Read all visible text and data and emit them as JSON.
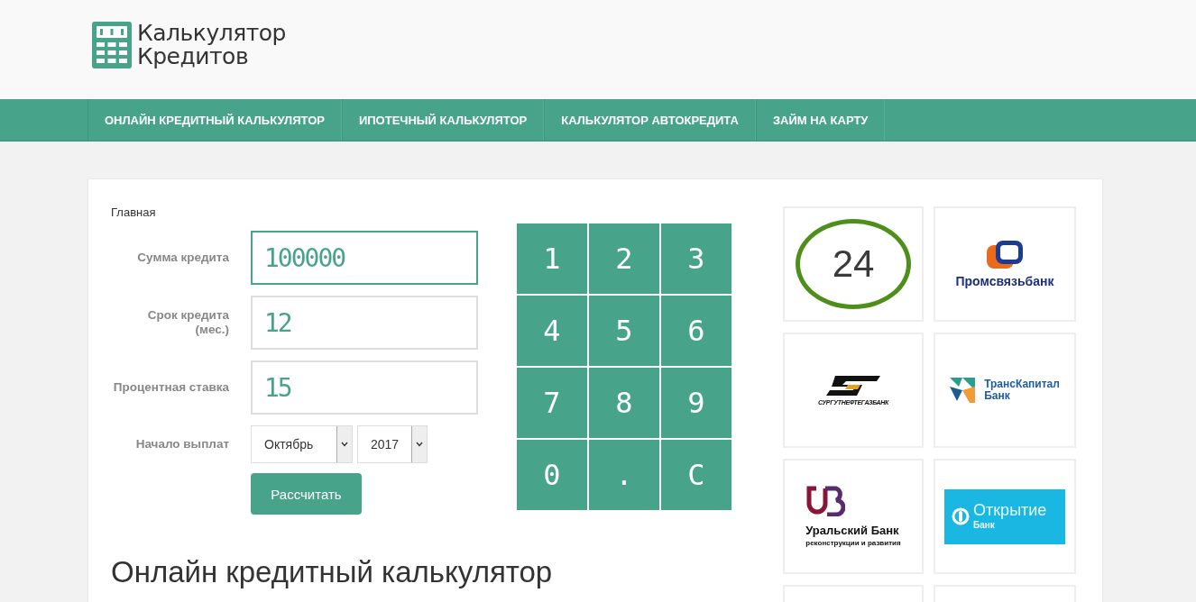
{
  "brand": {
    "line1": "Калькулятор",
    "line2": "Кредитов"
  },
  "nav": [
    {
      "label": "ОНЛАЙН КРЕДИТНЫЙ КАЛЬКУЛЯТОР"
    },
    {
      "label": "ИПОТЕЧНЫЙ КАЛЬКУЛЯТОР"
    },
    {
      "label": "КАЛЬКУЛЯТОР АВТОКРЕДИТА"
    },
    {
      "label": "ЗАЙМ НА КАРТУ"
    }
  ],
  "breadcrumb": "Главная",
  "fields": [
    {
      "label": "Сумма кредита",
      "value": "100000",
      "focused": true
    },
    {
      "label": "Срок кредита (мес.)",
      "value": "12",
      "focused": false
    },
    {
      "label": "Процентная ставка",
      "value": "15",
      "focused": false
    }
  ],
  "start": {
    "label": "Начало выплат",
    "month": "Октябрь",
    "year": "2017"
  },
  "calculate_button": "Рассчитать",
  "keypad": [
    "1",
    "2",
    "3",
    "4",
    "5",
    "6",
    "7",
    "8",
    "9",
    "0",
    ".",
    "C"
  ],
  "heading": "Онлайн кредитный калькулятор",
  "banks": [
    {
      "kind": "ring",
      "text": "24"
    },
    {
      "kind": "psb",
      "text": "Промсвязьбанк"
    },
    {
      "kind": "surgut",
      "text": "СУРГУТНЕФТЕГАЗБАНК"
    },
    {
      "kind": "transkapital",
      "text": "ТрансКапитал",
      "text2": "Банк"
    },
    {
      "kind": "ural",
      "text": "Уральский Банк",
      "text2": "реконструкции и развития"
    },
    {
      "kind": "otkritie",
      "text": "Открытие",
      "text2": "Банк"
    },
    {
      "kind": "blank"
    },
    {
      "kind": "blank"
    }
  ]
}
